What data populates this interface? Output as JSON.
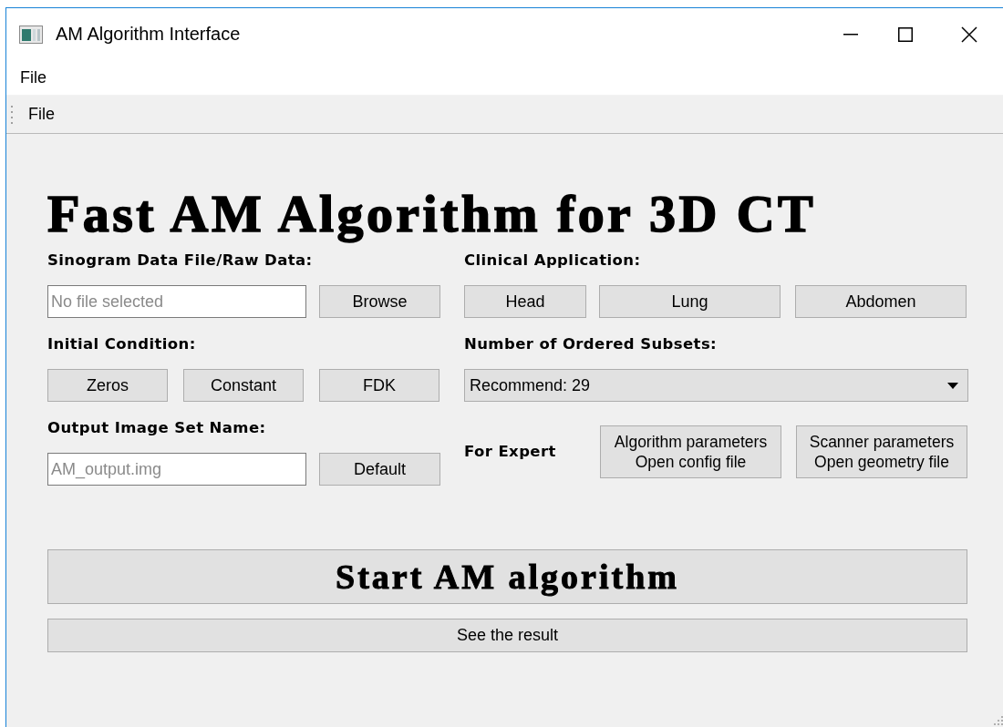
{
  "window": {
    "title": "AM Algorithm Interface"
  },
  "menu_bar": [
    {
      "label": "File"
    }
  ],
  "toolbar": [
    {
      "label": "File"
    }
  ],
  "heading": "Fast AM Algorithm for 3D CT",
  "sinogram": {
    "label": "Sinogram Data File/Raw Data:",
    "field": {
      "placeholder": "No file selected"
    },
    "button": "Browse"
  },
  "initial_condition": {
    "label": "Initial Condition:",
    "buttons": [
      "Zeros",
      "Constant",
      "FDK"
    ]
  },
  "output": {
    "label": "Output Image Set Name:",
    "field": {
      "placeholder": "AM_output.img"
    },
    "button": "Default"
  },
  "clinical_application": {
    "label": "Clinical Application:",
    "buttons": [
      "Head",
      "Lung",
      "Abdomen"
    ]
  },
  "ordered_subsets": {
    "label": "Number of Ordered Subsets:",
    "dropdown": {
      "value": "Recommend: 29"
    }
  },
  "expert": {
    "label": "For Expert",
    "buttons": [
      [
        "Algorithm parameters",
        "Open config file"
      ],
      [
        "Scanner parameters",
        "Open geometry file"
      ]
    ]
  },
  "start_button": "Start AM algorithm",
  "result_button": "See the result"
}
